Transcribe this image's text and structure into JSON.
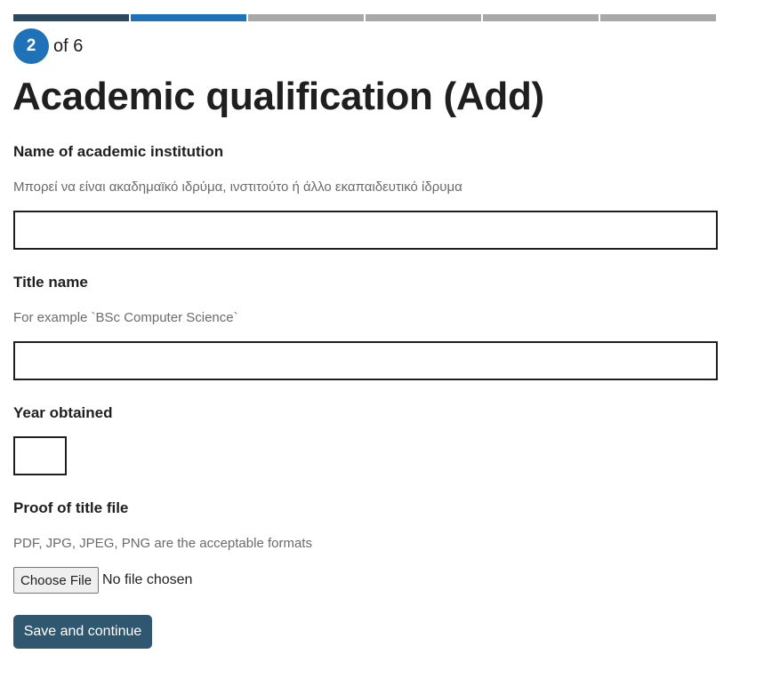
{
  "progress": {
    "current": 2,
    "total": 6,
    "of_text": "of 6",
    "colors": {
      "done": "#2b4a5f",
      "current": "#1f72b8",
      "pending": "#a8a8a8"
    }
  },
  "page": {
    "title": "Academic qualification (Add)"
  },
  "fields": {
    "institution": {
      "label": "Name of academic institution",
      "hint": "Μπορεί να είναι ακαδημαϊκό ιδρύμα, ινστιτούτο ή άλλο εκαπαιδευτικό ίδρυμα",
      "value": ""
    },
    "title_name": {
      "label": "Title name",
      "hint": "For example `BSc Computer Science`",
      "value": ""
    },
    "year": {
      "label": "Year obtained",
      "value": ""
    },
    "proof_file": {
      "label": "Proof of title file",
      "hint": "PDF, JPG, JPEG, PNG are the acceptable formats",
      "button_label": "Choose File",
      "status": "No file chosen"
    }
  },
  "actions": {
    "save_label": "Save and continue",
    "accent": "#2f5770"
  }
}
